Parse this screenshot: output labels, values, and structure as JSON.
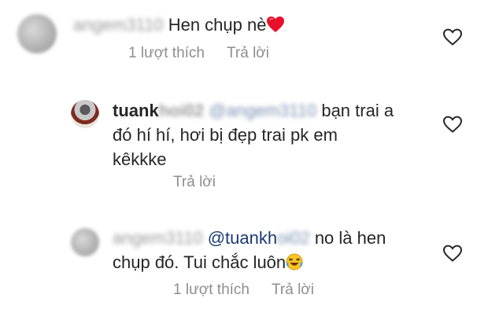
{
  "comments": [
    {
      "username": "angem3110",
      "text": "Hen chụp nè",
      "emoji": "red-heart",
      "likes_label": "1 lượt thích",
      "reply_label": "Trả lời"
    },
    {
      "username_visible": "tuank",
      "username_hidden": "hoi02",
      "mention": "@angem3110",
      "text_line1": "bạn trai a",
      "text_line2": "đó hí hí, hơi bị đẹp trai pk em",
      "text_line3": "kêkkke",
      "reply_label": "Trả lời"
    },
    {
      "username": "angem3110",
      "mention_visible": "@tuankh",
      "mention_hidden": "oi02",
      "text_line1": "no là hen",
      "text_line2": "chụp đó. Tui chắc luôn",
      "emoji": "rolling-on-floor-laughing",
      "likes_label": "1 lượt thích",
      "reply_label": "Trả lời"
    }
  ]
}
